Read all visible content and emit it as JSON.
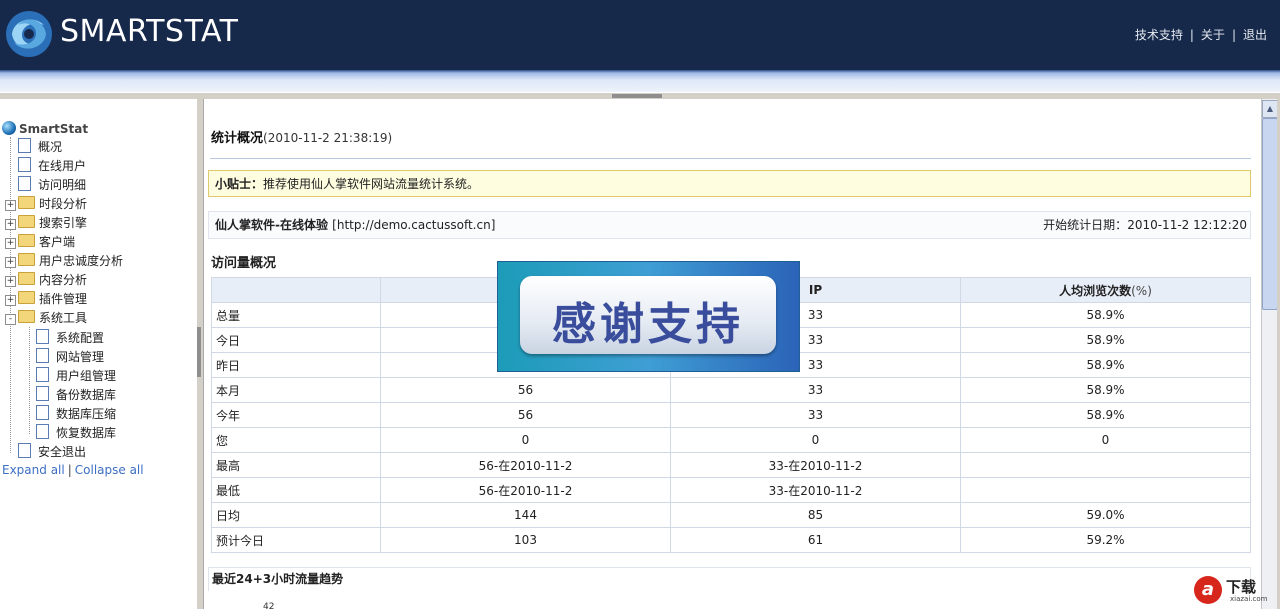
{
  "header": {
    "brand": "SMARTSTAT",
    "links": [
      "技术支持",
      "关于",
      "退出"
    ],
    "separator": "|"
  },
  "tree": {
    "root": "SmartStat",
    "items": [
      {
        "label": "概况",
        "type": "doc",
        "level": 1
      },
      {
        "label": "在线用户",
        "type": "doc",
        "level": 1
      },
      {
        "label": "访问明细",
        "type": "doc",
        "level": 1
      },
      {
        "label": "时段分析",
        "type": "folder",
        "level": 1,
        "expanded": false
      },
      {
        "label": "搜索引擎",
        "type": "folder",
        "level": 1,
        "expanded": false
      },
      {
        "label": "客户端",
        "type": "folder",
        "level": 1,
        "expanded": false
      },
      {
        "label": "用户忠诚度分析",
        "type": "folder",
        "level": 1,
        "expanded": false
      },
      {
        "label": "内容分析",
        "type": "folder",
        "level": 1,
        "expanded": false
      },
      {
        "label": "插件管理",
        "type": "folder",
        "level": 1,
        "expanded": false
      },
      {
        "label": "系统工具",
        "type": "folder",
        "level": 1,
        "expanded": true
      },
      {
        "label": "系统配置",
        "type": "doc",
        "level": 2
      },
      {
        "label": "网站管理",
        "type": "doc",
        "level": 2
      },
      {
        "label": "用户组管理",
        "type": "doc",
        "level": 2
      },
      {
        "label": "备份数据库",
        "type": "doc",
        "level": 2
      },
      {
        "label": "数据库压缩",
        "type": "doc",
        "level": 2
      },
      {
        "label": "恢复数据库",
        "type": "doc",
        "level": 2
      },
      {
        "label": "安全退出",
        "type": "doc",
        "level": 1
      }
    ],
    "expand_all": "Expand all",
    "sep": "|",
    "collapse_all": "Collapse all"
  },
  "main": {
    "title": "统计概况",
    "timestamp": "(2010-11-2 21:38:19)",
    "tip_label": "小贴士：",
    "tip_text": "推荐使用仙人掌软件网站流量统计系统。",
    "site_name": "仙人掌软件-在线体验",
    "site_url": "[http://demo.cactussoft.cn]",
    "start_label": "开始统计日期：",
    "start_date": "2010-11-2 12:12:20",
    "section_title": "访问量概况",
    "table": {
      "headers": [
        "",
        "",
        "IP",
        "人均浏览次数"
      ],
      "header_suffix": "(%)",
      "rows": [
        [
          "总量",
          "",
          "33",
          "58.9%"
        ],
        [
          "今日",
          "",
          "33",
          "58.9%"
        ],
        [
          "昨日",
          "",
          "33",
          "58.9%"
        ],
        [
          "本月",
          "56",
          "33",
          "58.9%"
        ],
        [
          "今年",
          "56",
          "33",
          "58.9%"
        ],
        [
          "您",
          "0",
          "0",
          "0"
        ],
        [
          "最高",
          "56-在2010-11-2",
          "33-在2010-11-2",
          ""
        ],
        [
          "最低",
          "56-在2010-11-2",
          "33-在2010-11-2",
          ""
        ],
        [
          "日均",
          "144",
          "85",
          "59.0%"
        ],
        [
          "预计今日",
          "103",
          "61",
          "59.2%"
        ]
      ]
    },
    "trend_title": "最近24+3小时流量趋势",
    "trend_y_first": "42"
  },
  "overlay": {
    "text": "感谢支持"
  },
  "watermark": {
    "logo_char": "a",
    "label": "下载",
    "site": "xiazai.com"
  },
  "colors": {
    "header_bg": "#16294a",
    "tip_bg": "#fffde0",
    "table_header_bg": "#e8eef8",
    "overlay_pill_text": "#3a4d9c"
  }
}
